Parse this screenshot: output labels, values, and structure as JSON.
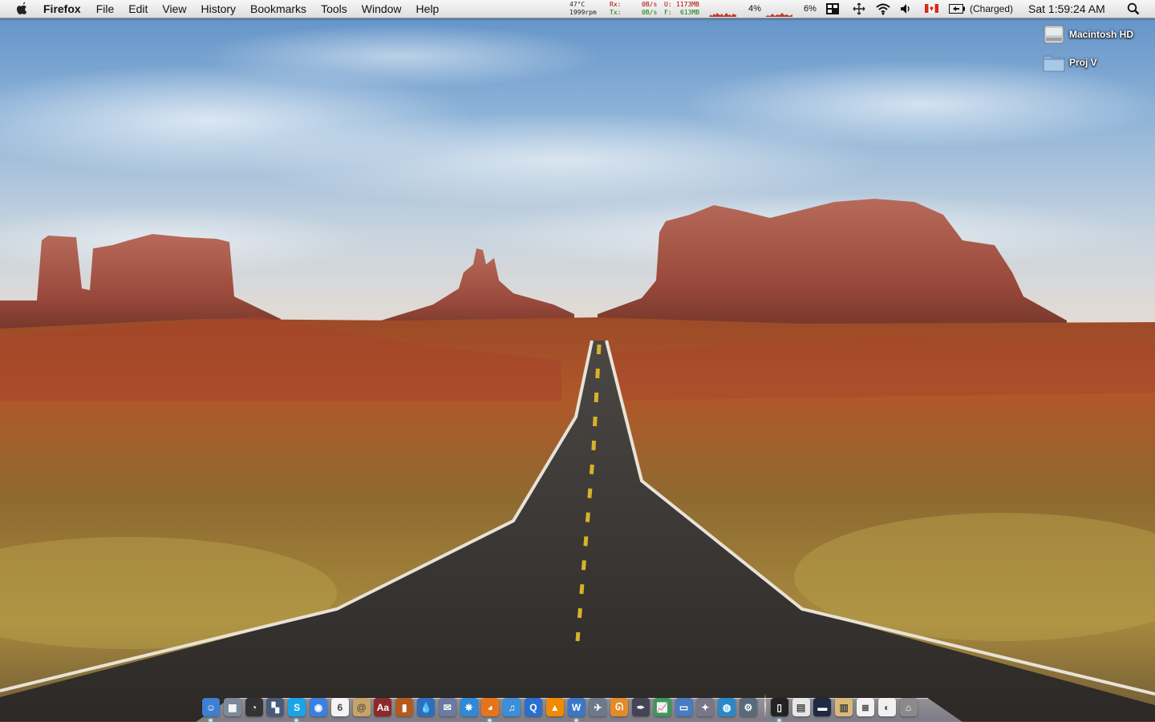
{
  "menubar": {
    "app_name": "Firefox",
    "menus": [
      "File",
      "Edit",
      "View",
      "History",
      "Bookmarks",
      "Tools",
      "Window",
      "Help"
    ]
  },
  "status": {
    "temperature": "47°C",
    "fan": "1999rpm",
    "rx_label": "Rx:",
    "tx_label": "Tx:",
    "rx_rate": "0B/s",
    "tx_rate": "0B/s",
    "used_label": "U:",
    "used_value": "1173MB",
    "free_label": "F:",
    "free_value": "613MB",
    "cpu1": "4%",
    "cpu2": "6%",
    "battery": "(Charged)",
    "clock": "Sat 1:59:24 AM"
  },
  "desktop_icons": [
    {
      "name": "Macintosh HD",
      "icon": "hard-drive-icon"
    },
    {
      "name": "Proj V",
      "icon": "folder-icon"
    }
  ],
  "dock": {
    "apps": [
      {
        "icon": "finder-icon",
        "color": "#3d7fd0",
        "glyph": "☺"
      },
      {
        "icon": "preview-icon",
        "color": "#7a8a99",
        "glyph": "▦"
      },
      {
        "icon": "clock-icon",
        "color": "#333333",
        "glyph": "◔"
      },
      {
        "icon": "spaces-icon",
        "color": "#4a5a7a",
        "glyph": "▚"
      },
      {
        "icon": "skype-icon",
        "color": "#1aa3e8",
        "glyph": "S"
      },
      {
        "icon": "ichat-icon",
        "color": "#3c7fe0",
        "glyph": "◉"
      },
      {
        "icon": "ical-icon",
        "color": "#f4f4f4",
        "glyph": "6"
      },
      {
        "icon": "address-book-icon",
        "color": "#c7a36a",
        "glyph": "@"
      },
      {
        "icon": "dictionary-icon",
        "color": "#8b2a2a",
        "glyph": "Aa"
      },
      {
        "icon": "notebook-icon",
        "color": "#b35a1f",
        "glyph": "▮"
      },
      {
        "icon": "water-drop-icon",
        "color": "#2d6fbf",
        "glyph": "💧"
      },
      {
        "icon": "photo-stamp-icon",
        "color": "#6a7aa0",
        "glyph": "✉"
      },
      {
        "icon": "safari-icon",
        "color": "#2f89d9",
        "glyph": "✵"
      },
      {
        "icon": "firefox-icon",
        "color": "#e8741a",
        "glyph": "◕"
      },
      {
        "icon": "itunes-icon",
        "color": "#3b8fd9",
        "glyph": "♫"
      },
      {
        "icon": "quicktime-icon",
        "color": "#2a6fd0",
        "glyph": "Q"
      },
      {
        "icon": "vlc-icon",
        "color": "#f08a00",
        "glyph": "▲"
      },
      {
        "icon": "word-icon",
        "color": "#3a78c6",
        "glyph": "W"
      },
      {
        "icon": "satellite-icon",
        "color": "#6b7a8a",
        "glyph": "✈"
      },
      {
        "icon": "swirl-icon",
        "color": "#e38a2a",
        "glyph": "ᘏ"
      },
      {
        "icon": "pen-tool-icon",
        "color": "#444455",
        "glyph": "✒"
      },
      {
        "icon": "chart-icon",
        "color": "#3a9a5a",
        "glyph": "📈"
      },
      {
        "icon": "keynote-icon",
        "color": "#4a7ac0",
        "glyph": "▭"
      },
      {
        "icon": "photo-booth-icon",
        "color": "#777788",
        "glyph": "✦"
      },
      {
        "icon": "globe-icon",
        "color": "#2a8ac8",
        "glyph": "◍"
      },
      {
        "icon": "utility-icon",
        "color": "#5a6a7a",
        "glyph": "⚙"
      }
    ],
    "docs": [
      {
        "icon": "terminal-icon",
        "color": "#222222",
        "glyph": "▯"
      },
      {
        "icon": "document-icon",
        "color": "#e6e6e6",
        "glyph": "▤"
      },
      {
        "icon": "desktop-folder-icon",
        "color": "#1d2a44",
        "glyph": "▬"
      },
      {
        "icon": "archive-icon",
        "color": "#d9b97a",
        "glyph": "▥"
      },
      {
        "icon": "text-file-icon",
        "color": "#f2f2f2",
        "glyph": "≣"
      },
      {
        "icon": "web-document-icon",
        "color": "#f0f0f0",
        "glyph": "◐"
      },
      {
        "icon": "trash-icon",
        "color": "#8a8a8a",
        "glyph": "⌂"
      }
    ]
  }
}
